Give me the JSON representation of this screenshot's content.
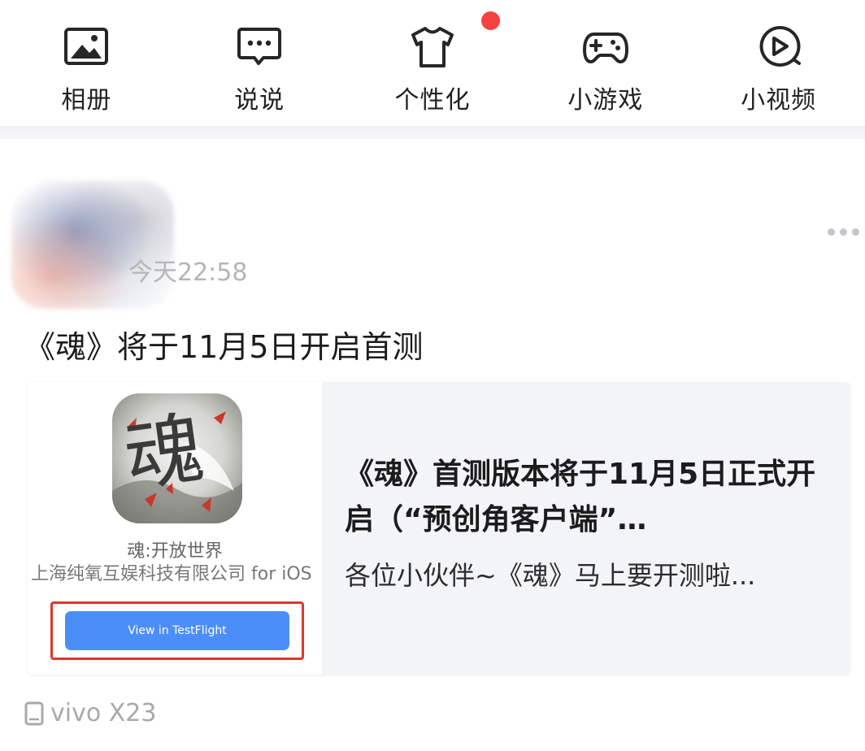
{
  "quick_nav": {
    "items": [
      {
        "label": "相册",
        "icon": "photo-album-icon"
      },
      {
        "label": "说说",
        "icon": "chat-bubble-icon"
      },
      {
        "label": "个性化",
        "icon": "tshirt-icon",
        "badge": "red-dot"
      },
      {
        "label": "小游戏",
        "icon": "gamepad-icon"
      },
      {
        "label": "小视频",
        "icon": "video-play-icon"
      }
    ]
  },
  "post": {
    "timestamp": "今天22:58",
    "title": "《魂》将于11月5日开启首测",
    "more_icon": "more-dots-icon",
    "shared_card": {
      "app_icon_text": "魂",
      "app_name": "魂:开放世界",
      "developer": "上海纯氧互娱科技有限公司 for iOS",
      "button_label": "View in TestFlight",
      "title": "《魂》首测版本将于11月5日正式开启（“预创角客户端”…",
      "description": "各位小伙伴~《魂》马上要开测啦..."
    },
    "device": {
      "icon": "phone-icon",
      "name": "vivo X23"
    }
  },
  "colors": {
    "badge_red": "#f5413f",
    "button_blue": "#4c8ef7",
    "highlight_red": "#d9392c",
    "card_bg": "#f3f4f8"
  }
}
